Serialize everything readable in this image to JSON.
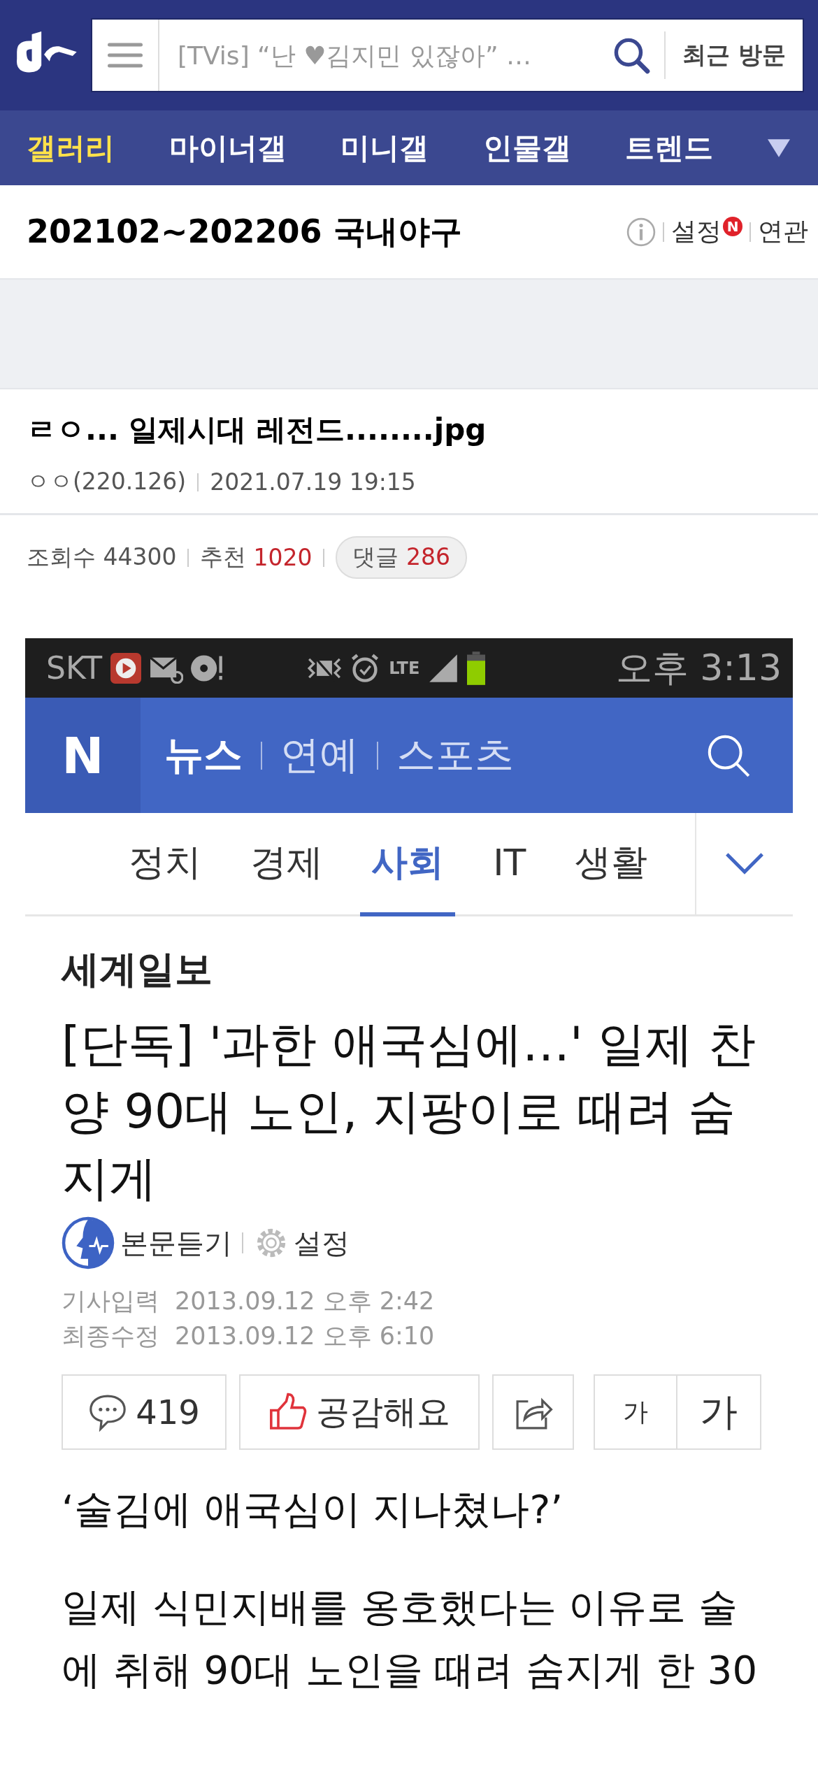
{
  "header": {
    "search_placeholder": "[TVis] “난 ♥김지민 있잖아” …",
    "recent_button": "최근 방문"
  },
  "nav": [
    {
      "label": "갤러리",
      "selected": true
    },
    {
      "label": "마이너갤",
      "selected": false
    },
    {
      "label": "미니갤",
      "selected": false
    },
    {
      "label": "인물갤",
      "selected": false
    },
    {
      "label": "트렌드",
      "selected": false
    }
  ],
  "gallery": {
    "title": "202102~202206 국내야구",
    "settings": "설정",
    "settings_badge": "N",
    "related": "연관"
  },
  "post": {
    "title": "ㄹㅇ... 일제시대 레전드........jpg",
    "author": "ㅇㅇ(220.126)",
    "date": "2021.07.19 19:15",
    "views_label": "조회수",
    "views": "44300",
    "recommend_label": "추천",
    "recommend": "1020",
    "comments_label": "댓글",
    "comments": "286"
  },
  "screenshot": {
    "status_bar": {
      "carrier": "SKT",
      "network": "LTE",
      "time": "오후 3:13"
    },
    "app_logo": "N",
    "sections": [
      {
        "label": "뉴스",
        "selected": true
      },
      {
        "label": "연예",
        "selected": false
      },
      {
        "label": "스포츠",
        "selected": false
      }
    ],
    "categories": [
      {
        "label": "정치",
        "selected": false
      },
      {
        "label": "경제",
        "selected": false
      },
      {
        "label": "사회",
        "selected": true
      },
      {
        "label": "IT",
        "selected": false
      },
      {
        "label": "생활",
        "selected": false
      }
    ],
    "article": {
      "publisher": "세계일보",
      "headline": "[단독] '과한 애국심에…' 일제 찬양 90대 노인, 지팡이로 때려 숨지게",
      "listen": "본문듣기",
      "settings": "설정",
      "dates": [
        {
          "label": "기사입력",
          "value": "2013.09.12 오후 2:42"
        },
        {
          "label": "최종수정",
          "value": "2013.09.12 오후 6:10"
        }
      ],
      "comment_count": "419",
      "like": "공감해요",
      "font_small": "가",
      "font_large": "가",
      "body": [
        "‘술김에 애국심이 지나쳤나?’",
        "일제 식민지배를 옹호했다는 이유로 술에 취해 90대 노인을 때려 숨지게 한 30"
      ]
    }
  }
}
